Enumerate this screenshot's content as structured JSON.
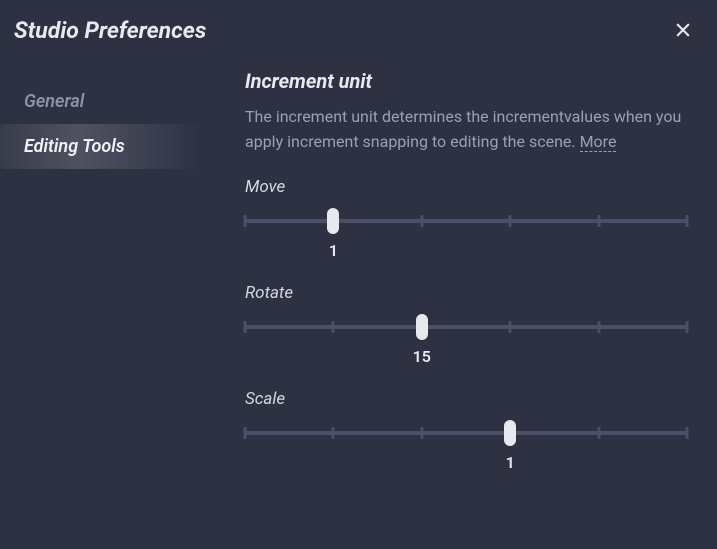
{
  "header": {
    "title": "Studio Preferences"
  },
  "sidebar": {
    "items": [
      {
        "label": "General",
        "active": false
      },
      {
        "label": "Editing Tools",
        "active": true
      }
    ]
  },
  "content": {
    "section_title": "Increment unit",
    "section_desc": "The increment unit determines the incrementvalues when you apply increment snapping to editing the scene.",
    "more_label": "More",
    "sliders": [
      {
        "label": "Move",
        "value": "1",
        "thumb_percent": 20
      },
      {
        "label": "Rotate",
        "value": "15",
        "thumb_percent": 40
      },
      {
        "label": "Scale",
        "value": "1",
        "thumb_percent": 60
      }
    ]
  },
  "tick_positions": [
    0,
    20,
    40,
    60,
    80,
    100
  ]
}
